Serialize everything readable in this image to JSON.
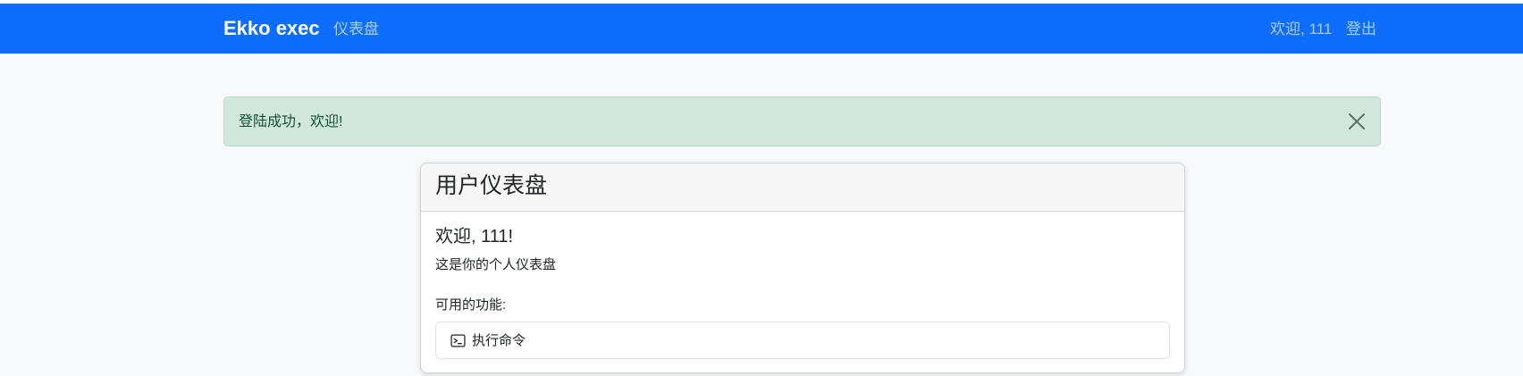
{
  "navbar": {
    "brand": "Ekko exec",
    "dashboard_link": "仪表盘",
    "welcome_text": "欢迎, 111",
    "logout_link": "登出",
    "background_color": "#0d6efd"
  },
  "alert": {
    "message": "登陆成功，欢迎!",
    "close_icon": "close-icon",
    "background_color": "#d1e7dd"
  },
  "card": {
    "title": "用户仪表盘",
    "welcome_heading": "欢迎, 111!",
    "subtitle": "这是你的个人仪表盘",
    "features_label": "可用的功能:",
    "features": [
      {
        "icon": "terminal-icon",
        "label": "执行命令"
      }
    ]
  }
}
